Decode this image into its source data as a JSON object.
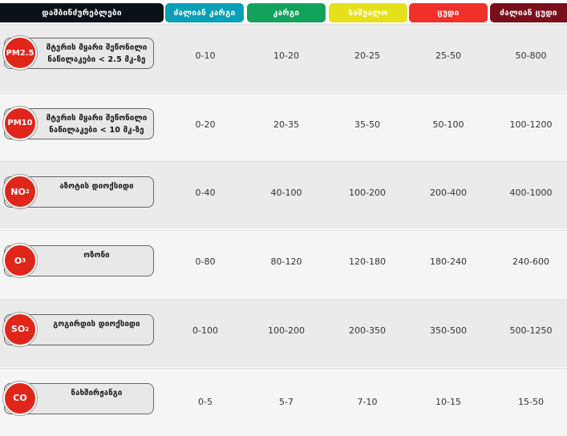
{
  "header": {
    "pollutants": "დამბინძურებლები",
    "levels": [
      {
        "label": "ძალიან კარგი",
        "color": "#0a9fb7"
      },
      {
        "label": "კარგი",
        "color": "#13a25c"
      },
      {
        "label": "საშუალო",
        "color": "#e6e01c"
      },
      {
        "label": "ცუდი",
        "color": "#f2302a"
      },
      {
        "label": "ძალიან ცუდი",
        "color": "#7a0f1c"
      }
    ],
    "pollutants_color": "#0a1218"
  },
  "rows": [
    {
      "badge": {
        "base": "PM2.5",
        "sub": ""
      },
      "label": "მტვრის მყარი შეწონილი ნაწილაკები < 2.5 მკ-ზე",
      "values": [
        "0-10",
        "10-20",
        "20-25",
        "25-50",
        "50-800"
      ]
    },
    {
      "badge": {
        "base": "PM10",
        "sub": ""
      },
      "label": "მტვრის მყარი შეწონილი ნაწილაკები < 10 მკ-ზე",
      "values": [
        "0-20",
        "20-35",
        "35-50",
        "50-100",
        "100-1200"
      ]
    },
    {
      "badge": {
        "base": "NO",
        "sub": "2"
      },
      "label": "აზოტის დიოქსიდი",
      "values": [
        "0-40",
        "40-100",
        "100-200",
        "200-400",
        "400-1000"
      ]
    },
    {
      "badge": {
        "base": "O",
        "sub": "3"
      },
      "label": "ოზონი",
      "values": [
        "0-80",
        "80-120",
        "120-180",
        "180-240",
        "240-600"
      ]
    },
    {
      "badge": {
        "base": "SO",
        "sub": "2"
      },
      "label": "გოგირდის დიოქსიდი",
      "values": [
        "0-100",
        "100-200",
        "200-350",
        "350-500",
        "500-1250"
      ]
    },
    {
      "badge": {
        "base": "CO",
        "sub": ""
      },
      "label": "ნახშირჟანგი",
      "values": [
        "0-5",
        "5-7",
        "7-10",
        "10-15",
        "15-50"
      ]
    }
  ],
  "badge_color": "#e0261b"
}
